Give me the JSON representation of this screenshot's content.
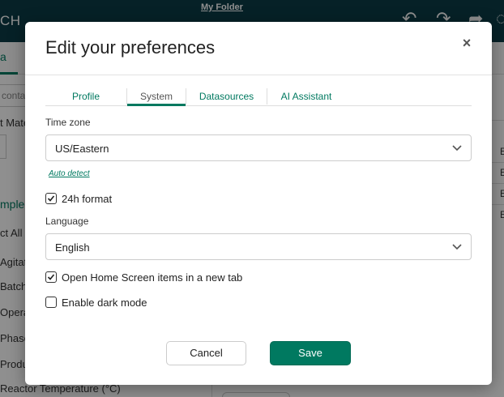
{
  "app": {
    "title_fragment": "CH",
    "folder_link": "My Folder",
    "tab_fragment": "a"
  },
  "background": {
    "search_fragment": "conta",
    "left_items": [
      "t Mate",
      "mple",
      "ct All",
      "Agitat",
      "Batch",
      "Opera",
      "Phase",
      "Produ",
      "Reactor Temperature (°C)"
    ],
    "grid_letter": "E"
  },
  "modal": {
    "title": "Edit your preferences",
    "close_glyph": "×",
    "tabs": [
      {
        "label": "Profile",
        "active": false
      },
      {
        "label": "System",
        "active": true
      },
      {
        "label": "Datasources",
        "active": false
      },
      {
        "label": "AI Assistant",
        "active": false
      }
    ],
    "timezone": {
      "label": "Time zone",
      "value": "US/Eastern",
      "auto_detect": "Auto detect"
    },
    "format_24h": {
      "label": "24h format",
      "checked": true
    },
    "language": {
      "label": "Language",
      "value": "English"
    },
    "open_new_tab": {
      "label": "Open Home Screen items in a new tab",
      "checked": true
    },
    "dark_mode": {
      "label": "Enable dark mode",
      "checked": false
    },
    "buttons": {
      "cancel": "Cancel",
      "save": "Save"
    }
  },
  "colors": {
    "accent": "#007960",
    "topbar": "#0c3b46"
  },
  "icons": [
    "undo-icon",
    "redo-icon",
    "forward-icon",
    "chevron-down-icon",
    "check-icon",
    "pin-icon",
    "close-icon"
  ]
}
